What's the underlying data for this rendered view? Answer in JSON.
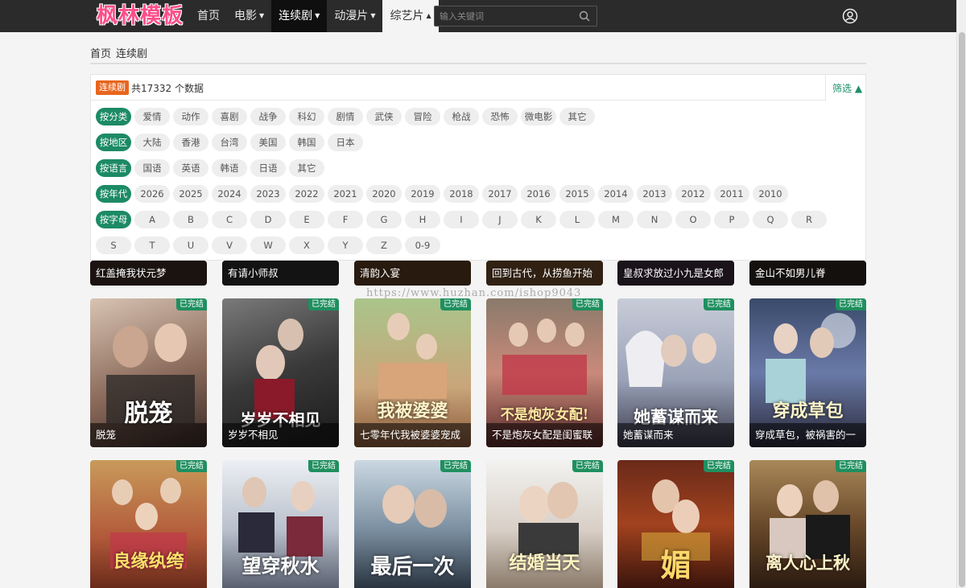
{
  "brand": {
    "logo_text": "枫林模板"
  },
  "nav": {
    "items": [
      {
        "label": "首页",
        "caret": ""
      },
      {
        "label": "电影",
        "caret": "▼"
      },
      {
        "label": "连续剧",
        "caret": "▼"
      },
      {
        "label": "动漫片",
        "caret": "▼"
      },
      {
        "label": "综艺片",
        "caret": "▲"
      }
    ]
  },
  "search": {
    "placeholder": "输入关键词",
    "value": ""
  },
  "breadcrumb": {
    "home": "首页",
    "current": "连续剧"
  },
  "filter": {
    "tag": "连续剧",
    "count_text": "共17332 个数据",
    "toggle_label": "筛选 ▲",
    "rows": [
      {
        "label": "按分类",
        "items": [
          "爱情",
          "动作",
          "喜剧",
          "战争",
          "科幻",
          "剧情",
          "武侠",
          "冒险",
          "枪战",
          "恐怖",
          "微电影",
          "其它"
        ]
      },
      {
        "label": "按地区",
        "items": [
          "大陆",
          "香港",
          "台湾",
          "美国",
          "韩国",
          "日本"
        ]
      },
      {
        "label": "按语言",
        "items": [
          "国语",
          "英语",
          "韩语",
          "日语",
          "其它"
        ]
      },
      {
        "label": "按年代",
        "items": [
          "2026",
          "2025",
          "2024",
          "2023",
          "2022",
          "2021",
          "2020",
          "2019",
          "2018",
          "2017",
          "2016",
          "2015",
          "2014",
          "2013",
          "2012",
          "2011",
          "2010"
        ]
      },
      {
        "label": "按字母",
        "items": [
          "A",
          "B",
          "C",
          "D",
          "E",
          "F",
          "G",
          "H",
          "I",
          "J",
          "K",
          "L",
          "M",
          "N",
          "O",
          "P",
          "Q",
          "R"
        ]
      },
      {
        "label": "",
        "items": [
          "S",
          "T",
          "U",
          "V",
          "W",
          "X",
          "Y",
          "Z",
          "0-9"
        ]
      }
    ]
  },
  "watermark": "https://www.huzhan.com/ishop9043",
  "status_label": "已完结",
  "row1": [
    "红盖掩我状元梦",
    "有请小师叔",
    "清韵入宴",
    "回到古代，从捞鱼开始",
    "皇叔求放过小九是女郎",
    "金山不如男儿脊"
  ],
  "row2": [
    {
      "title": "脱笼",
      "art_text": "脱笼"
    },
    {
      "title": "岁岁不相见",
      "art_text": "岁岁不相见"
    },
    {
      "title": "七零年代我被婆婆宠成",
      "art_text": "我被婆婆"
    },
    {
      "title": "不是炮灰女配是闺蜜联",
      "art_text": "不是炮灰女配!"
    },
    {
      "title": "她蓄谋而来",
      "art_text": "她蓄谋而来"
    },
    {
      "title": "穿成草包，被祸害的一",
      "art_text": "穿成草包"
    }
  ],
  "row3": [
    {
      "art_text": "良缘纨绔"
    },
    {
      "art_text": "望穿秋水"
    },
    {
      "art_text": "最后一次"
    },
    {
      "art_text": "结婚当天"
    },
    {
      "art_text": "媚"
    },
    {
      "art_text": "离人心上秋"
    }
  ],
  "colors": {
    "accent_green": "#1c8a65",
    "tag_orange": "#e8651e",
    "nav_bg": "#2b2b2b",
    "logo_pink": "#ff4d8a"
  }
}
